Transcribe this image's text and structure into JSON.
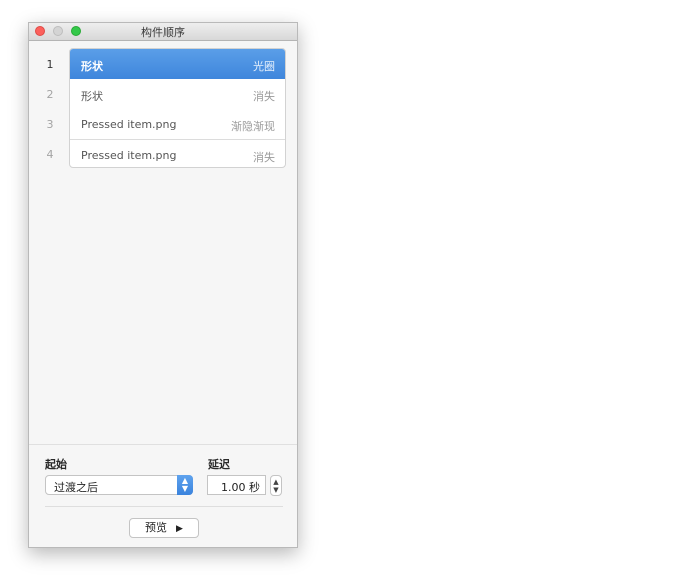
{
  "window": {
    "title": "构件顺序"
  },
  "builds": [
    {
      "number": "1",
      "name": "形状",
      "effect": "光圈",
      "selected": true
    },
    {
      "number": "2",
      "name": "形状",
      "effect": "消失",
      "selected": false
    },
    {
      "number": "3",
      "name": "Pressed item.png",
      "effect": "渐隐渐现",
      "selected": false
    },
    {
      "number": "4",
      "name": "Pressed item.png",
      "effect": "消失",
      "selected": false
    }
  ],
  "start": {
    "label": "起始",
    "value": "过渡之后"
  },
  "delay": {
    "label": "延迟",
    "value": "1.00 秒"
  },
  "preview": {
    "label": "预览"
  },
  "colors": {
    "selection": "#4a90e2",
    "window_bg": "#f6f6f6"
  }
}
